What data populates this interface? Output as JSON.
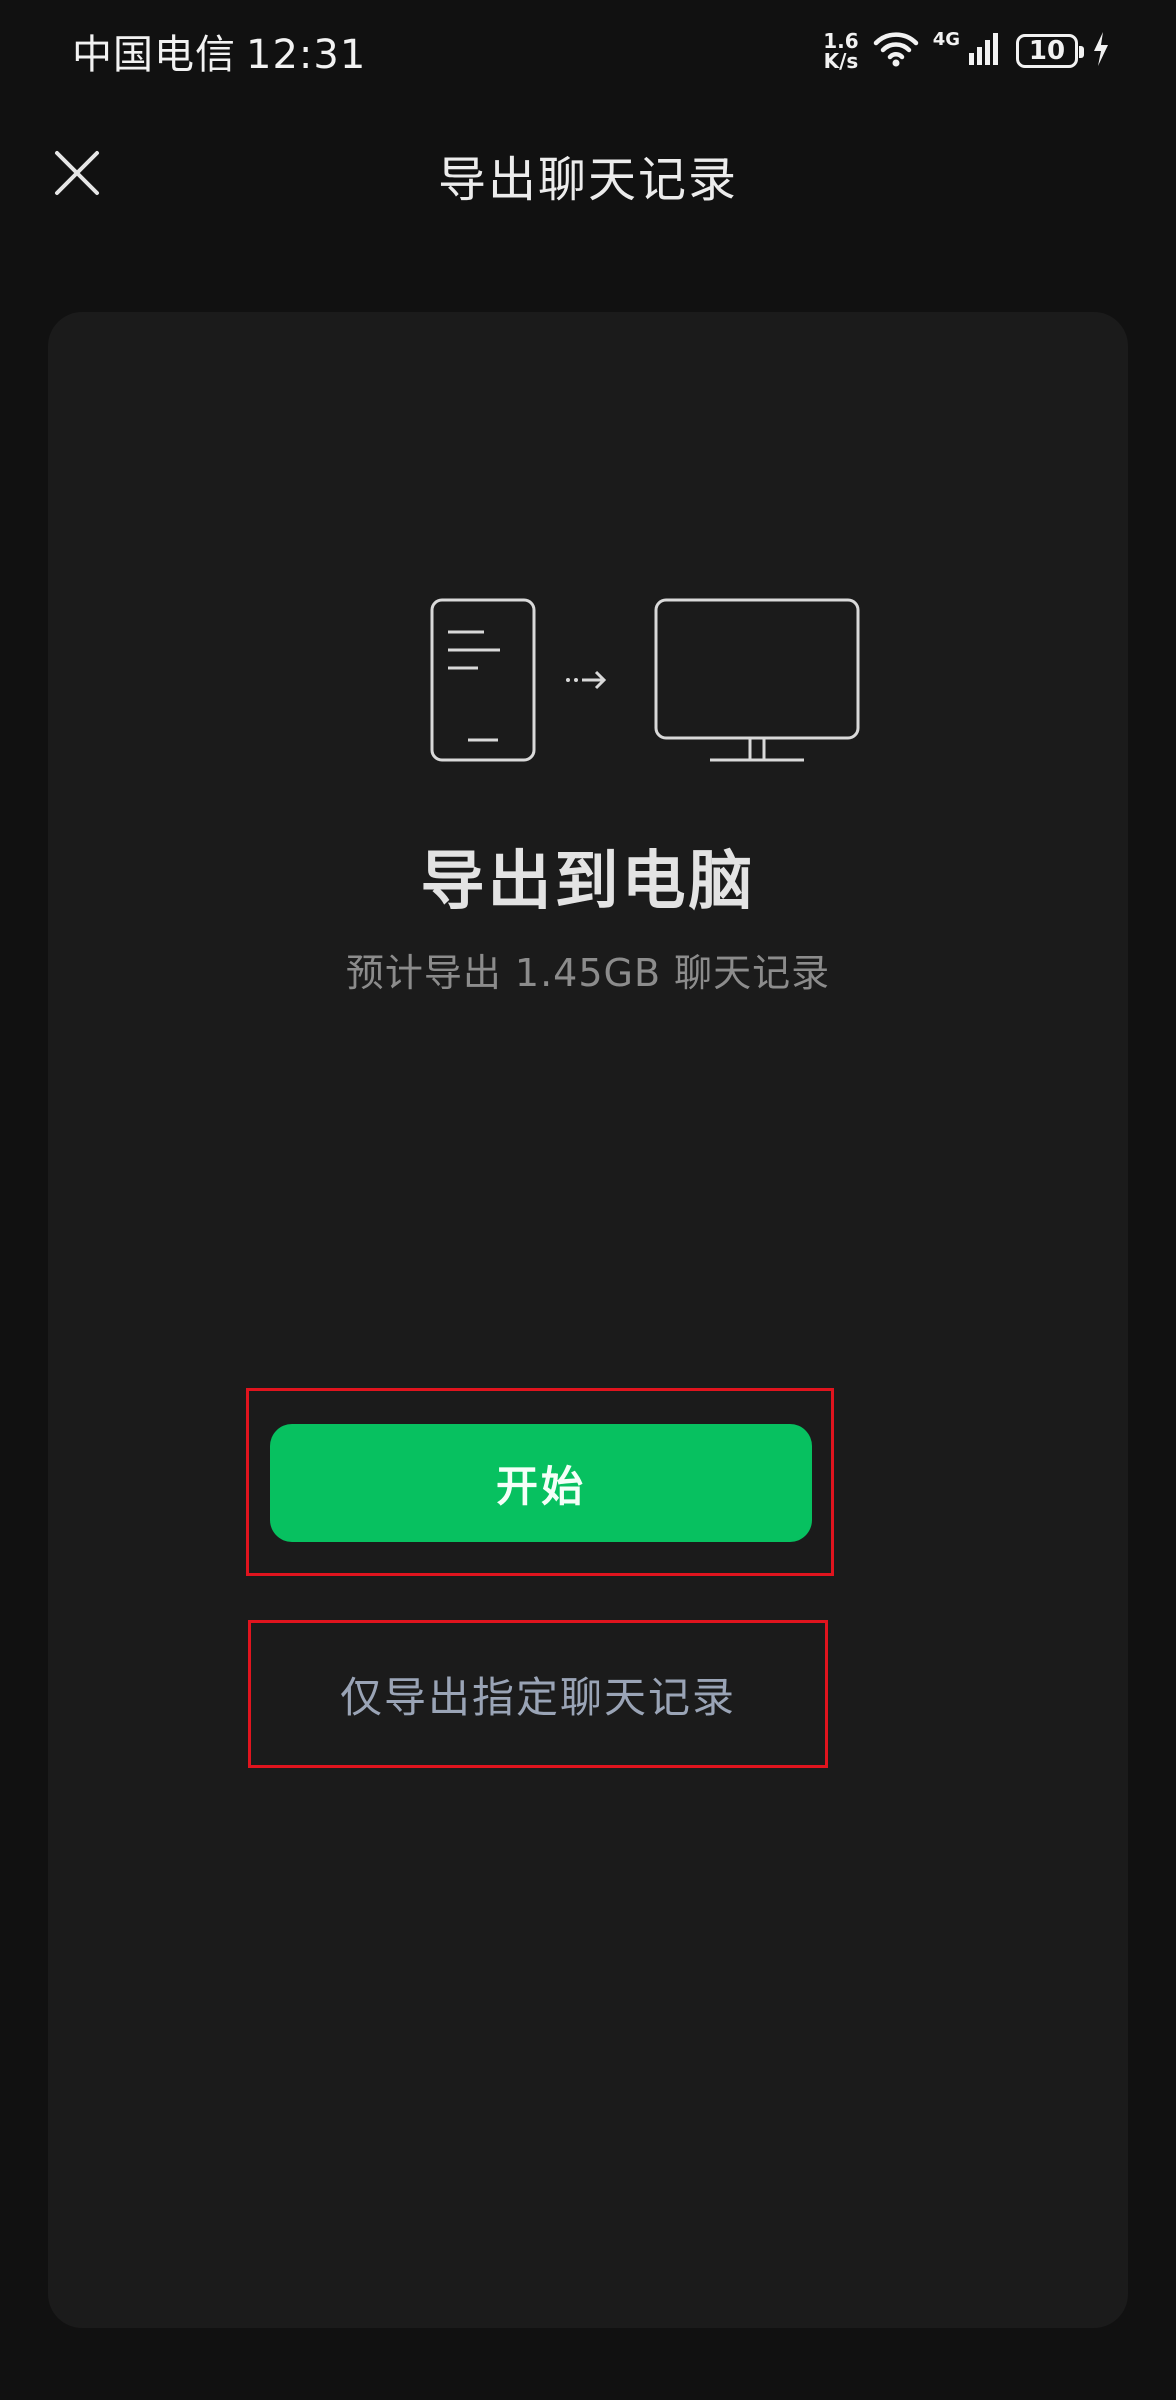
{
  "status_bar": {
    "carrier": "中国电信",
    "time": "12:31",
    "net_speed_value": "1.6",
    "net_speed_unit": "K/s",
    "network_type": "4G",
    "battery_level": "10"
  },
  "header": {
    "title": "导出聊天记录",
    "close_icon": "close-icon"
  },
  "main": {
    "illustration": {
      "left_icon": "phone-icon",
      "middle_icon": "arrow-right-icon",
      "right_icon": "monitor-icon"
    },
    "headline": "导出到电脑",
    "subtitle": "预计导出 1.45GB 聊天记录"
  },
  "actions": {
    "start_label": "开始",
    "partial_export_label": "仅导出指定聊天记录"
  },
  "colors": {
    "background": "#111111",
    "card": "#1b1b1b",
    "primary": "#07c160",
    "link_text": "#9aa4b6",
    "highlight_border": "#e0141e"
  }
}
